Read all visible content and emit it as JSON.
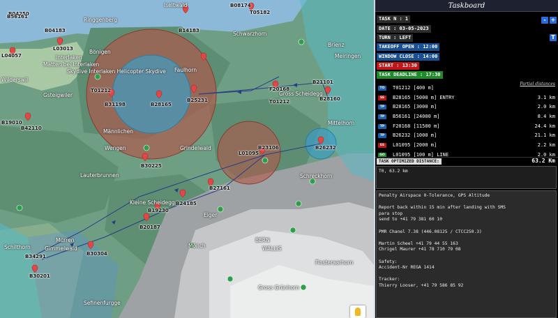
{
  "taskboard": {
    "title": "Taskboard",
    "task_n": "TASK N : 1",
    "date": "DATE : 03-05-2023",
    "turn": "TURN : LEFT",
    "takeoff_open": "TAKEOFF OPEN : 12:00",
    "window_close": "WINDOW CLOSE : 14:00",
    "start": "START : 13:30",
    "task_deadline": "TASK DEADLINE : 17:30",
    "minus_btn": "-",
    "plus_btn": "+",
    "t_btn": "T",
    "partial_distances": "Partial distances",
    "turnpoints": [
      {
        "badge": "TO",
        "badge_color": "#1e5fb3",
        "name": "T01212 [400 m]",
        "dist": ""
      },
      {
        "badge": "SS",
        "badge_color": "#c0161a",
        "name": "B28165 [5000 m] ENTRY",
        "dist": "3.1 km"
      },
      {
        "badge": "TP",
        "badge_color": "#1e5fb3",
        "name": "B28165 [3000 m]",
        "dist": "2.0 km"
      },
      {
        "badge": "TP",
        "badge_color": "#1e5fb3",
        "name": "B56161 [24000 m]",
        "dist": "8.4 km"
      },
      {
        "badge": "TP",
        "badge_color": "#1e5fb3",
        "name": "F20168 [11500 m]",
        "dist": "24.4 km"
      },
      {
        "badge": "TP",
        "badge_color": "#1e5fb3",
        "name": "B26232 [1000 m]",
        "dist": "21.1 km"
      },
      {
        "badge": "ES",
        "badge_color": "#c0161a",
        "name": "L01095 [2000 m]",
        "dist": "2.2 km"
      },
      {
        "badge": "GO",
        "badge_color": "#1f8a2a",
        "name": "L01095 [100 m] LINE",
        "dist": "2.0 km"
      }
    ],
    "optimized_label": "TASK OPTIMIZED DISTANCE:",
    "optimized_value": "63.2 Km",
    "summary": "T0, 63.2 km",
    "info_lines": [
      "Penalty Airspace 0-Tolerance, GPS Altitude",
      "",
      "Report back within 15 min after landing with SMS",
      "para stop",
      "send to +41 79 381 60 10",
      "",
      "PMR Chanel 7.38 (446.08125 / CTCC250.3)",
      "",
      "Martin Scheel +41 79 44 55 163",
      "Chrigel Maurer +41 78 710 79 08",
      "",
      "Safety:",
      "Accident-Nr REGA 1414",
      "",
      "Tracker:",
      "Thierry Looser, +41 79 586 85 92"
    ]
  },
  "map": {
    "places": [
      "Iseltwald",
      "Ringgenberg",
      "Interlaken",
      "Bönigen",
      "Matten bei Interlaken",
      "Skydive Interlaken Helicopter Skydive",
      "Wilderswil",
      "Gsteigwiler",
      "Wengen",
      "Lauterbrunnen",
      "Grindelwald",
      "Schwarzhorn",
      "Faulhorn",
      "Männlichen",
      "Gross Scheidegg",
      "Meiringen",
      "Kleine Scheidegg",
      "Mönch",
      "Eiger",
      "Schreckhorn",
      "Finsteraarhorn",
      "Gross Grünhorn",
      "BERN",
      "WALLIS",
      "Mürren",
      "Gimmelwald",
      "Brienz",
      "Mittelhorn",
      "Schilthorn",
      "Sefinenfurgge"
    ],
    "waypoints": [
      "B14183",
      "B04183",
      "L04057",
      "L03013",
      "T01212",
      "B31198",
      "B28165",
      "B25231",
      "B04250",
      "B56161",
      "B42110",
      "B19010",
      "B30225",
      "L01095",
      "B23106",
      "B21101",
      "F20168",
      "B26232",
      "T01212",
      "B28160",
      "B27161",
      "B19230",
      "B24185",
      "B20187",
      "B34291",
      "B30201",
      "B30304",
      "T05182",
      "B08174"
    ],
    "colors": {
      "terrain_green": "#6fa587",
      "lake_blue": "#8db9d8",
      "airspace_red": "#b85a4e",
      "airspace_blue": "#3b9cc0",
      "glacier": "#e7e8ea",
      "route": "#283c86"
    }
  }
}
